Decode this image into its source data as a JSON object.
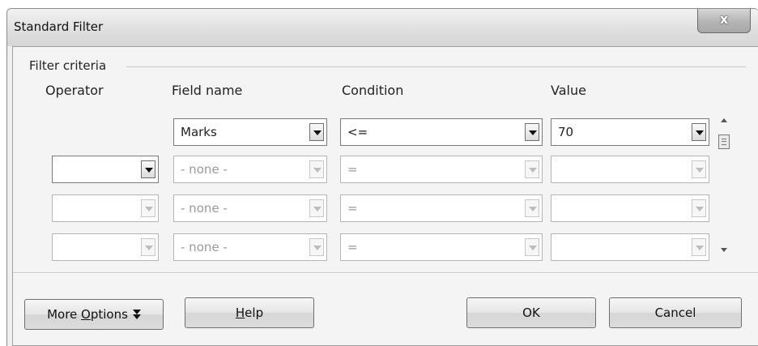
{
  "window": {
    "title": "Standard Filter",
    "close_label": "x"
  },
  "group": {
    "label": "Filter criteria"
  },
  "columns": {
    "operator": "Operator",
    "field_name": "Field name",
    "condition": "Condition",
    "value": "Value"
  },
  "rows": [
    {
      "operator": "",
      "field": "Marks",
      "condition": "<=",
      "value": "70"
    },
    {
      "operator": "",
      "field": "- none -",
      "condition": "=",
      "value": ""
    },
    {
      "operator": "",
      "field": "- none -",
      "condition": "=",
      "value": ""
    },
    {
      "operator": "",
      "field": "- none -",
      "condition": "=",
      "value": ""
    }
  ],
  "buttons": {
    "more_options_prefix": "More ",
    "more_options_mnemonic": "O",
    "more_options_suffix": "ptions",
    "help_mnemonic": "H",
    "help_suffix": "elp",
    "ok": "OK",
    "cancel": "Cancel"
  },
  "icons": {
    "close": "close-icon",
    "dropdown": "chevron-down-icon",
    "scroll_up": "scroll-up-icon",
    "scroll_down": "scroll-down-icon",
    "more_options": "double-chevron-down-icon"
  }
}
